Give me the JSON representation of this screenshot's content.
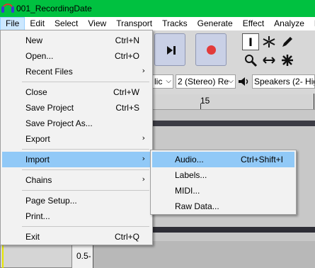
{
  "window": {
    "title": "001_RecordingDate"
  },
  "menubar": {
    "items": [
      "File",
      "Edit",
      "Select",
      "View",
      "Transport",
      "Tracks",
      "Generate",
      "Effect",
      "Analyze",
      "Help"
    ],
    "active": "File"
  },
  "devices": {
    "host_fragment": "lic",
    "channels": "2 (Stereo) Re",
    "output": "Speakers (2- Hig"
  },
  "ruler": {
    "label": "15"
  },
  "track": {
    "scale_label": "0.5-"
  },
  "file_menu": {
    "items": [
      {
        "label": "New",
        "shortcut": "Ctrl+N"
      },
      {
        "label": "Open...",
        "shortcut": "Ctrl+O"
      },
      {
        "label": "Recent Files",
        "submenu": true
      },
      {
        "label": "Close",
        "shortcut": "Ctrl+W"
      },
      {
        "label": "Save Project",
        "shortcut": "Ctrl+S"
      },
      {
        "label": "Save Project As..."
      },
      {
        "label": "Export",
        "submenu": true
      },
      {
        "label": "Import",
        "submenu": true,
        "highlighted": true
      },
      {
        "label": "Chains",
        "submenu": true
      },
      {
        "label": "Page Setup..."
      },
      {
        "label": "Print..."
      },
      {
        "label": "Exit",
        "shortcut": "Ctrl+Q"
      }
    ]
  },
  "import_menu": {
    "items": [
      {
        "label": "Audio...",
        "shortcut": "Ctrl+Shift+I",
        "highlighted": true
      },
      {
        "label": "Labels..."
      },
      {
        "label": "MIDI..."
      },
      {
        "label": "Raw Data..."
      }
    ]
  },
  "colors": {
    "titlebar": "#00c140",
    "menu_highlight": "#91c9f7",
    "record": "#e23b3b"
  }
}
